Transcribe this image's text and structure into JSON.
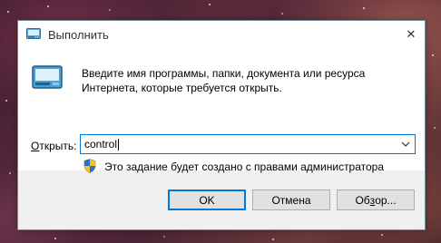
{
  "window": {
    "title": "Выполнить",
    "close_glyph": "✕"
  },
  "dialog": {
    "description": "Введите имя программы, папки, документа или ресурса Интернета, которые требуется открыть.",
    "open_label_mnemonic": "О",
    "open_label_rest": "ткрыть:",
    "command_value": "control",
    "admin_note": "Это задание будет создано с правами администратора"
  },
  "buttons": {
    "ok": "OK",
    "cancel": "Отмена",
    "browse_prefix": "Об",
    "browse_mnemonic": "з",
    "browse_suffix": "ор..."
  },
  "icons": {
    "title": "run-icon",
    "main": "run-icon",
    "close": "close-icon",
    "dropdown": "chevron-down-icon",
    "shield": "uac-shield-icon"
  },
  "colors": {
    "accent": "#0078d7",
    "window_border": "#6b8e9a",
    "dialog_bg": "#f0f0f0",
    "content_bg": "#ffffff",
    "button_bg": "#e1e1e1"
  }
}
